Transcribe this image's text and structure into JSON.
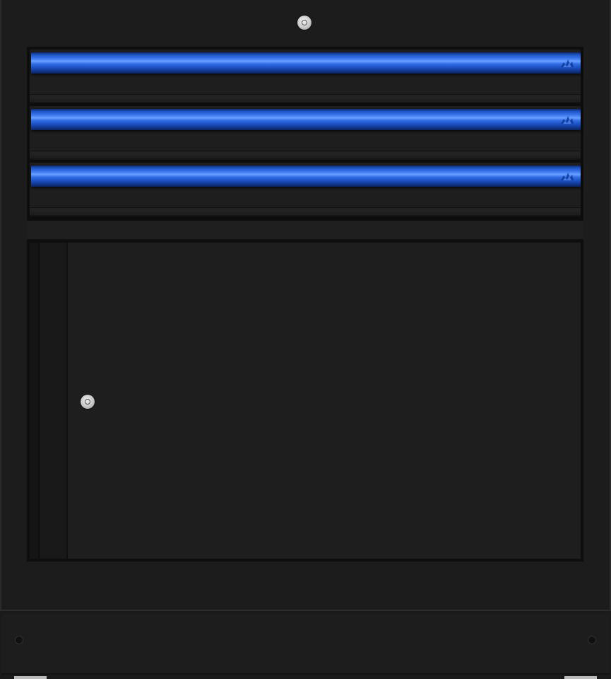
{
  "product": {
    "type": "tool-storage-cabinet",
    "body_color": "#1c1c1c",
    "accent_color": "#2f6de6",
    "lock_color": "#c9c9c9"
  },
  "drawers": [
    {
      "handle_icon": "flame-logo-icon"
    },
    {
      "handle_icon": "flame-logo-icon"
    },
    {
      "handle_icon": "flame-logo-icon"
    }
  ],
  "door": {
    "lock_icon": "lock-icon"
  },
  "plinth": {
    "bolt_icon": "bolt-icon"
  }
}
